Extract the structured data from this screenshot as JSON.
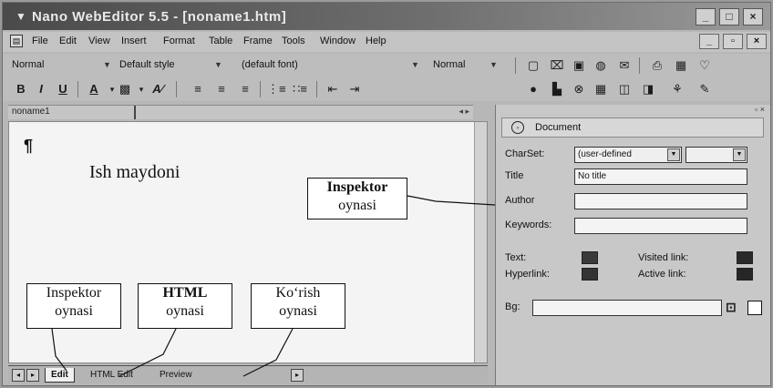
{
  "window": {
    "title": "Nano WebEditor 5.5 - [noname1.htm]",
    "buttons": {
      "minimize": "_",
      "maximize": "□",
      "close": "×"
    }
  },
  "menu": {
    "items": [
      "File",
      "Edit",
      "View",
      "Insert",
      "Format",
      "Table",
      "Frame",
      "Tools",
      "Window",
      "Help"
    ],
    "mdi_buttons": {
      "minimize": "_",
      "restore": "▫",
      "close": "×"
    }
  },
  "toolbar": {
    "paragraph_style": "Normal",
    "css_style": "Default style",
    "font": "(default font)",
    "font_size": "Normal"
  },
  "doc_tab": {
    "name": "noname1"
  },
  "editor": {
    "pilcrow": "¶",
    "area_label": "Ish  maydoni"
  },
  "callouts": {
    "inspector_main": {
      "line1": "Inspektor",
      "line2": "oynasi"
    },
    "inspector_tab": {
      "line1": "Inspektor",
      "line2": "oynasi"
    },
    "html_tab": {
      "line1": "HTML",
      "line2": "oynasi"
    },
    "preview_tab": {
      "line1": "Ko‘rish",
      "line2": "oynasi"
    }
  },
  "bottom_tabs": [
    "Edit",
    "HTML Edit",
    "Preview"
  ],
  "inspector": {
    "section_title": "Document",
    "charset_label": "CharSet:",
    "charset_value": "(user-defined",
    "title_label": "Title",
    "title_value": "No title",
    "author_label": "Author",
    "author_value": "",
    "keywords_label": "Keywords:",
    "keywords_value": "",
    "text_label": "Text:",
    "visited_label": "Visited link:",
    "hyperlink_label": "Hyperlink:",
    "active_label": "Active link:",
    "bg_label": "Bg:",
    "bg_value": "",
    "colors": {
      "text": "#3a3a3a",
      "visited": "#2a2a2a",
      "hyperlink": "#333333",
      "active": "#262626"
    }
  }
}
